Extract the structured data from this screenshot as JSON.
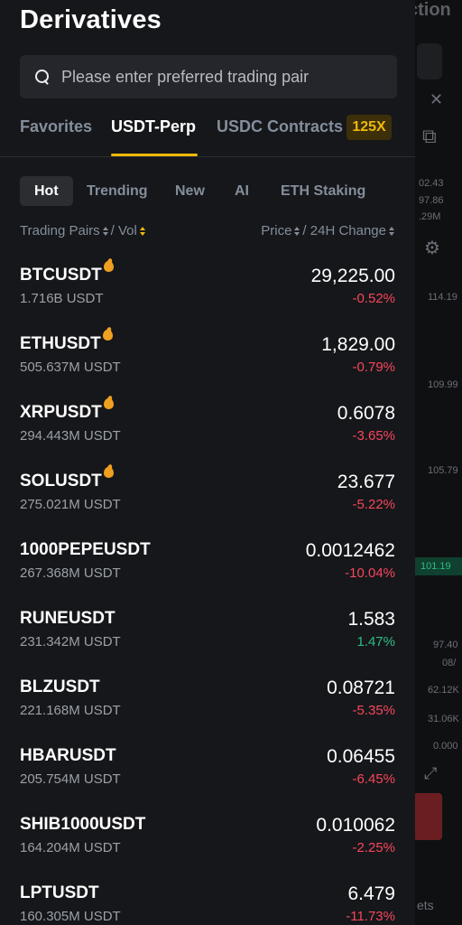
{
  "background": {
    "title_fragment": "ction",
    "values": [
      "02.43",
      "97.86",
      ".29M",
      "114.19",
      "109.99",
      "105.79",
      "101.19",
      "97.40",
      "08/",
      "62.12K",
      "31.06K",
      "0.000",
      "ets"
    ],
    "highlight_value": "101.19"
  },
  "drawer": {
    "title": "Derivatives",
    "search": {
      "placeholder": "Please enter preferred trading pair",
      "value": ""
    },
    "tabs": [
      {
        "label": "Favorites",
        "active": false
      },
      {
        "label": "USDT-Perp",
        "active": true
      },
      {
        "label": "USDC Contracts",
        "active": false
      }
    ],
    "leverage_badge": "125X",
    "chips": [
      {
        "label": "Hot",
        "active": true
      },
      {
        "label": "Trending",
        "active": false
      },
      {
        "label": "New",
        "active": false
      },
      {
        "label": "AI",
        "active": false
      },
      {
        "label": "ETH Staking",
        "active": false
      }
    ],
    "columns": {
      "left_a": "Trading Pairs",
      "left_sep": "/",
      "left_b": "Vol",
      "right_a": "Price",
      "right_sep": "/",
      "right_b": "24H Change"
    },
    "pairs": [
      {
        "symbol": "BTCUSDT",
        "hot": true,
        "volume": "1.716B USDT",
        "price": "29,225.00",
        "change": "-0.52%",
        "direction": "down"
      },
      {
        "symbol": "ETHUSDT",
        "hot": true,
        "volume": "505.637M USDT",
        "price": "1,829.00",
        "change": "-0.79%",
        "direction": "down"
      },
      {
        "symbol": "XRPUSDT",
        "hot": true,
        "volume": "294.443M USDT",
        "price": "0.6078",
        "change": "-3.65%",
        "direction": "down"
      },
      {
        "symbol": "SOLUSDT",
        "hot": true,
        "volume": "275.021M USDT",
        "price": "23.677",
        "change": "-5.22%",
        "direction": "down"
      },
      {
        "symbol": "1000PEPEUSDT",
        "hot": false,
        "volume": "267.368M USDT",
        "price": "0.0012462",
        "change": "-10.04%",
        "direction": "down"
      },
      {
        "symbol": "RUNEUSDT",
        "hot": false,
        "volume": "231.342M USDT",
        "price": "1.583",
        "change": "1.47%",
        "direction": "up"
      },
      {
        "symbol": "BLZUSDT",
        "hot": false,
        "volume": "221.168M USDT",
        "price": "0.08721",
        "change": "-5.35%",
        "direction": "down"
      },
      {
        "symbol": "HBARUSDT",
        "hot": false,
        "volume": "205.754M USDT",
        "price": "0.06455",
        "change": "-6.45%",
        "direction": "down"
      },
      {
        "symbol": "SHIB1000USDT",
        "hot": false,
        "volume": "164.204M USDT",
        "price": "0.010062",
        "change": "-2.25%",
        "direction": "down"
      },
      {
        "symbol": "LPTUSDT",
        "hot": false,
        "volume": "160.305M USDT",
        "price": "6.479",
        "change": "-11.73%",
        "direction": "down"
      }
    ]
  },
  "colors": {
    "accent": "#f0b90b",
    "negative": "#f6465d",
    "positive": "#2ebd85",
    "panel": "#16171a"
  }
}
